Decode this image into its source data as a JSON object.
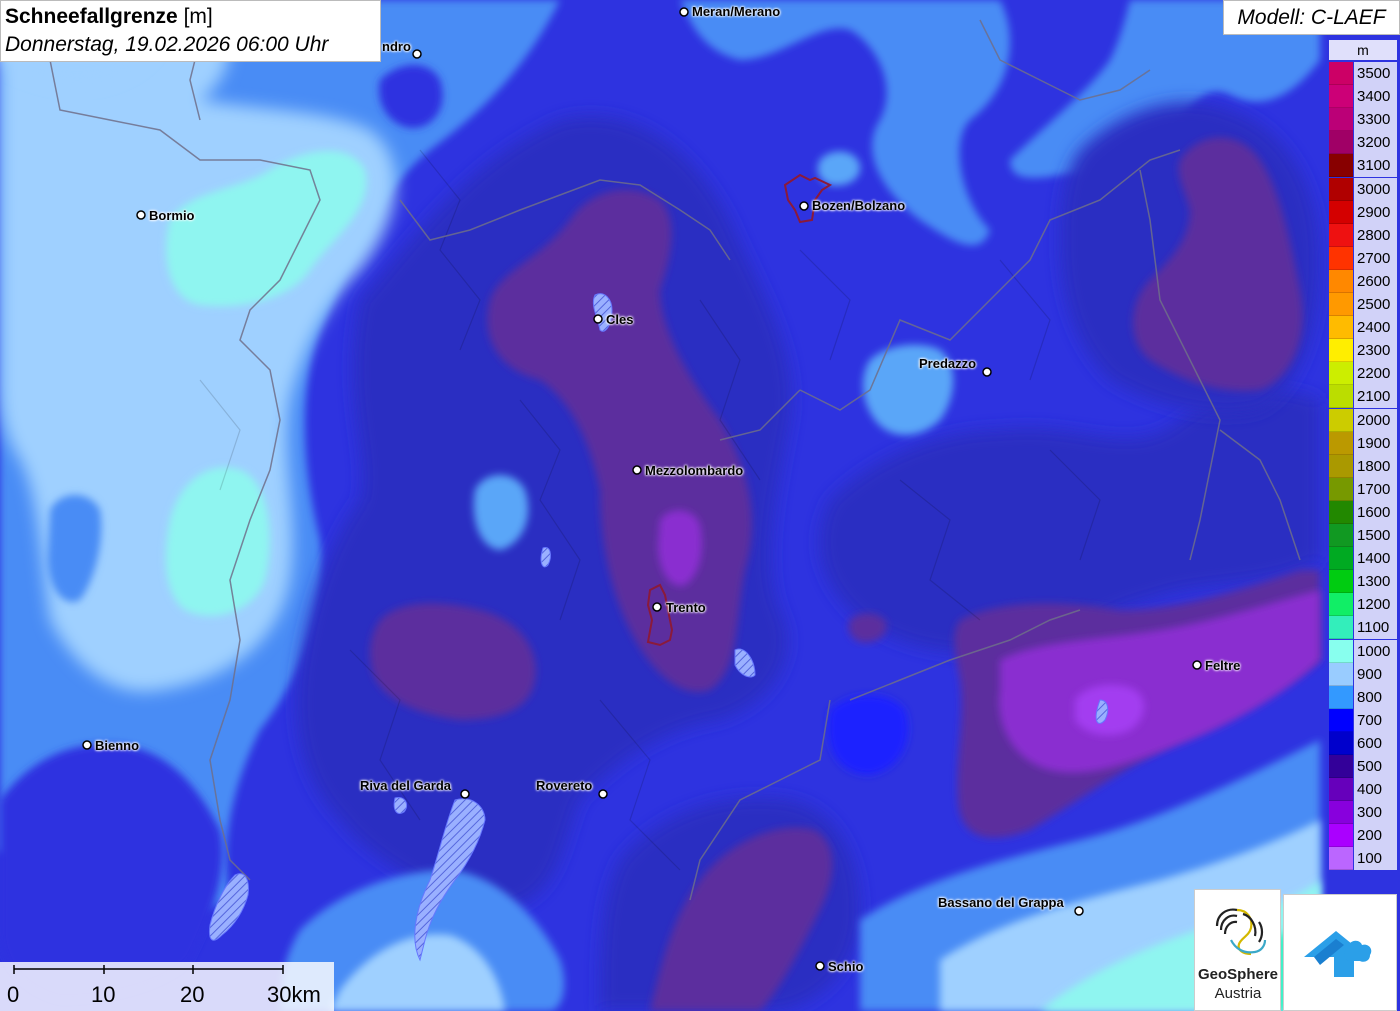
{
  "title": {
    "name": "Schneefallgrenze",
    "unit": "[m]",
    "datetime": "Donnerstag, 19.02.2026 06:00 Uhr"
  },
  "model": "Modell: C-LAEF",
  "legend": {
    "unit": "m",
    "entries": [
      {
        "label": "3500",
        "color": "#cc0066"
      },
      {
        "label": "3400",
        "color": "#cc0077"
      },
      {
        "label": "3300",
        "color": "#bb0077"
      },
      {
        "label": "3200",
        "color": "#a00066"
      },
      {
        "label": "3100",
        "color": "#880000"
      },
      {
        "label": "3000",
        "color": "#b00000"
      },
      {
        "label": "2900",
        "color": "#d40000"
      },
      {
        "label": "2800",
        "color": "#ee1111"
      },
      {
        "label": "2700",
        "color": "#ff3300"
      },
      {
        "label": "2600",
        "color": "#ff8800"
      },
      {
        "label": "2500",
        "color": "#ff9900"
      },
      {
        "label": "2400",
        "color": "#ffbb00"
      },
      {
        "label": "2300",
        "color": "#ffee00"
      },
      {
        "label": "2200",
        "color": "#ccee00"
      },
      {
        "label": "2100",
        "color": "#bbdd00"
      },
      {
        "label": "2000",
        "color": "#cccc00"
      },
      {
        "label": "1900",
        "color": "#bb9900"
      },
      {
        "label": "1800",
        "color": "#aa9900"
      },
      {
        "label": "1700",
        "color": "#779900"
      },
      {
        "label": "1600",
        "color": "#228800"
      },
      {
        "label": "1500",
        "color": "#119922"
      },
      {
        "label": "1400",
        "color": "#00aa22"
      },
      {
        "label": "1300",
        "color": "#00cc11"
      },
      {
        "label": "1200",
        "color": "#11ee66"
      },
      {
        "label": "1100",
        "color": "#33eebb"
      },
      {
        "label": "1000",
        "color": "#88ffee"
      },
      {
        "label": "900",
        "color": "#99ccff"
      },
      {
        "label": "800",
        "color": "#3399ff"
      },
      {
        "label": "700",
        "color": "#0000ff"
      },
      {
        "label": "600",
        "color": "#0000cc"
      },
      {
        "label": "500",
        "color": "#330099"
      },
      {
        "label": "400",
        "color": "#6600bb"
      },
      {
        "label": "300",
        "color": "#8800dd"
      },
      {
        "label": "200",
        "color": "#aa00ff"
      },
      {
        "label": "100",
        "color": "#bb66ff"
      }
    ]
  },
  "cities": [
    {
      "id": "meran",
      "name": "Meran/Merano"
    },
    {
      "id": "sondrio",
      "name": "ndro"
    },
    {
      "id": "bormio",
      "name": "Bormio"
    },
    {
      "id": "bozen",
      "name": "Bozen/Bolzano"
    },
    {
      "id": "cles",
      "name": "Cles"
    },
    {
      "id": "predazzo",
      "name": "Predazzo"
    },
    {
      "id": "mezzolombardo",
      "name": "Mezzolombardo"
    },
    {
      "id": "trento",
      "name": "Trento"
    },
    {
      "id": "feltre",
      "name": "Feltre"
    },
    {
      "id": "bienno",
      "name": "Bienno"
    },
    {
      "id": "riva",
      "name": "Riva del Garda"
    },
    {
      "id": "rovereto",
      "name": "Rovereto"
    },
    {
      "id": "bassano",
      "name": "Bassano del Grappa"
    },
    {
      "id": "schio",
      "name": "Schio"
    }
  ],
  "scale": {
    "labels": [
      "0",
      "10",
      "20",
      "30km"
    ]
  },
  "logo": {
    "line1": "GeoSphere",
    "line2": "Austria"
  },
  "colors": {
    "light_cyan": "#88ffee",
    "light_blue": "#99ccff",
    "mid_blue": "#3399ff",
    "blue": "#1a1aff",
    "dark_blue": "#2a2ad0",
    "purple": "#5a2a9a",
    "violet": "#8a2acc"
  }
}
